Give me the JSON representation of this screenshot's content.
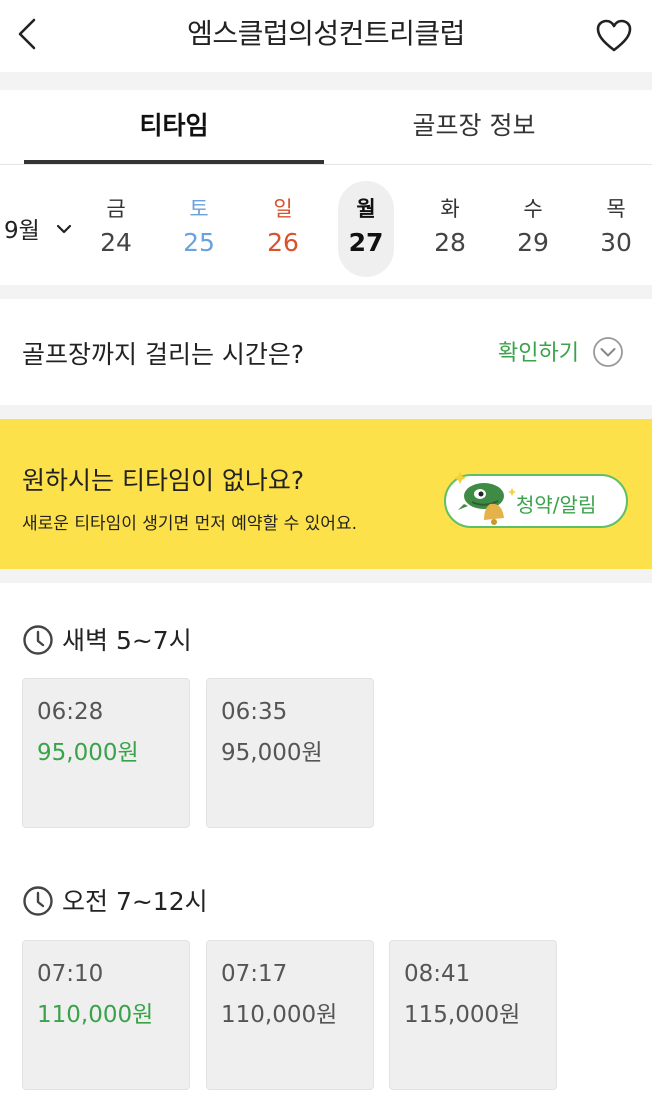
{
  "header": {
    "title": "엠스클럽의성컨트리클럽"
  },
  "tabs": [
    {
      "label": "티타임"
    },
    {
      "label": "골프장 정보"
    }
  ],
  "dates": {
    "month": "9월",
    "days": [
      {
        "weekday": "금",
        "day": "24"
      },
      {
        "weekday": "토",
        "day": "25"
      },
      {
        "weekday": "일",
        "day": "26"
      },
      {
        "weekday": "월",
        "day": "27"
      },
      {
        "weekday": "화",
        "day": "28"
      },
      {
        "weekday": "수",
        "day": "29"
      },
      {
        "weekday": "목",
        "day": "30"
      }
    ],
    "selected_index": 3
  },
  "travel": {
    "question": "골프장까지 걸리는 시간은?",
    "link_label": "확인하기"
  },
  "banner": {
    "title": "원하시는 티타임이 없나요?",
    "subtitle": "새로운 티타임이 생기면 먼저 예약할 수 있어요.",
    "button_label": "청약/알림"
  },
  "sections": [
    {
      "heading": "새벽 5~7시",
      "slots": [
        {
          "time": "06:28",
          "price": "95,000원",
          "highlight": true
        },
        {
          "time": "06:35",
          "price": "95,000원",
          "highlight": false
        }
      ]
    },
    {
      "heading": "오전 7~12시",
      "slots": [
        {
          "time": "07:10",
          "price": "110,000원",
          "highlight": true
        },
        {
          "time": "07:17",
          "price": "110,000원",
          "highlight": false
        },
        {
          "time": "08:41",
          "price": "115,000원",
          "highlight": false
        }
      ]
    }
  ],
  "colors": {
    "accent_green": "#3aa34a",
    "banner_yellow": "#fde14a",
    "saturday_blue": "#6aa2dd",
    "sunday_red": "#d9522c"
  }
}
